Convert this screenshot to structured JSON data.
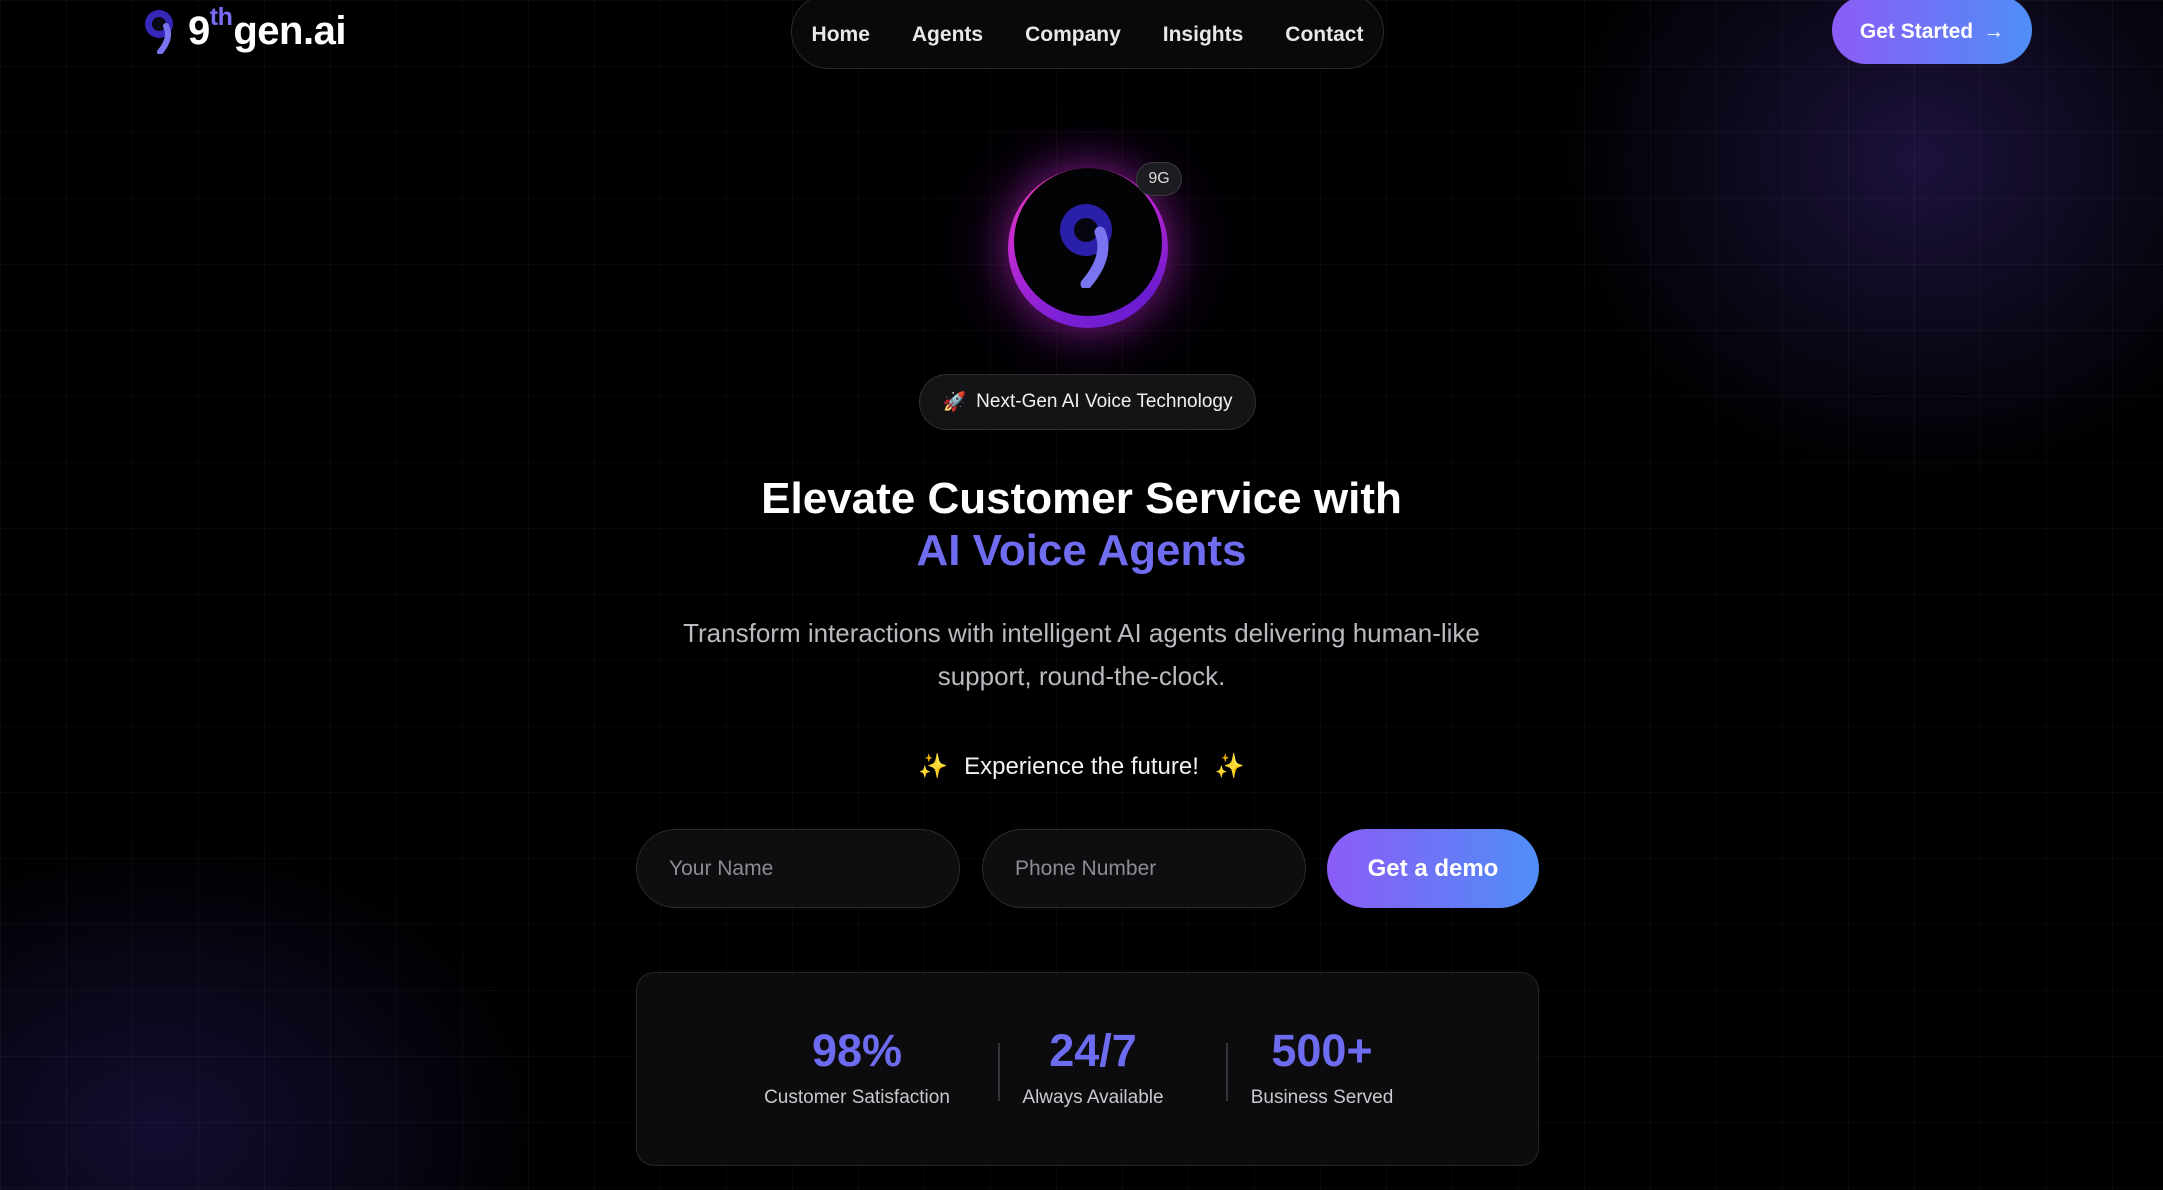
{
  "header": {
    "logo": {
      "base": "9",
      "sup": "th",
      "rest": "gen.ai"
    },
    "nav": [
      "Home",
      "Agents",
      "Company",
      "Insights",
      "Contact"
    ],
    "cta_label": "Get Started",
    "cta_arrow": "→"
  },
  "hero": {
    "avatar_badge": "9G",
    "pill_icon": "🚀",
    "pill_text": "Next-Gen AI Voice Technology",
    "title_line1": "Elevate Customer Service with",
    "title_line2": "AI Voice Agents",
    "subtitle": "Transform interactions with intelligent AI agents delivering human-like support, round-the-clock.",
    "tagline": "Experience the future!",
    "tagline_icon": "✨"
  },
  "form": {
    "name_placeholder": "Your Name",
    "phone_placeholder": "Phone Number",
    "submit_label": "Get a demo"
  },
  "stats": [
    {
      "value": "98%",
      "label": "Customer Satisfaction"
    },
    {
      "value": "24/7",
      "label": "Always Available"
    },
    {
      "value": "500+",
      "label": "Business Served"
    }
  ],
  "colors": {
    "accent_purple": "#8b5cf6",
    "accent_blue": "#4f8ef7",
    "headline_accent": "#6f6cf0",
    "background": "#000000"
  },
  "icons": [
    "logo-nine-icon",
    "arrow-right-icon",
    "rocket-icon",
    "sparkles-icon"
  ]
}
